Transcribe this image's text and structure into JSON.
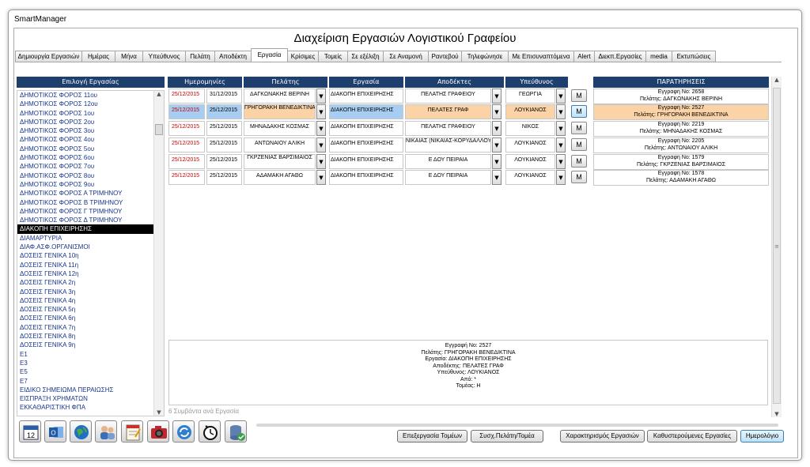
{
  "window_title": "SmartManager",
  "app_title": "Διαχείριση Εργασιών Λογιστικού Γραφείου",
  "tabs": [
    "Δημιουργία Εργασιών",
    "Ημέρας",
    "Μήνα",
    "Υπεύθυνος",
    "Πελάτη",
    "Αποδέκτη",
    "Εργασία",
    "Κρίσιμες",
    "Τομείς",
    "Σε εξέλιξη",
    "Σε Αναμονή",
    "Ραντεβού",
    "Τηλεφώνησε",
    "Με Επισυναπτόμενα",
    "Alert",
    "Διεκπ.Εργασίες",
    "media",
    "Εκτυπώσεις"
  ],
  "active_tab": "Εργασία",
  "left_header": "Επιλογή Εργασίας",
  "task_list": [
    "ΔΗΜΟΤΙΚΟΣ ΦΟΡΟΣ 11ου",
    "ΔΗΜΟΤΙΚΟΣ ΦΟΡΟΣ 12ου",
    "ΔΗΜΟΤΙΚΟΣ ΦΟΡΟΣ 1ου",
    "ΔΗΜΟΤΙΚΟΣ ΦΟΡΟΣ 2ου",
    "ΔΗΜΟΤΙΚΟΣ ΦΟΡΟΣ 3ου",
    "ΔΗΜΟΤΙΚΟΣ ΦΟΡΟΣ 4ου",
    "ΔΗΜΟΤΙΚΟΣ ΦΟΡΟΣ 5ου",
    "ΔΗΜΟΤΙΚΟΣ ΦΟΡΟΣ 6ου",
    "ΔΗΜΟΤΙΚΟΣ ΦΟΡΟΣ 7ου",
    "ΔΗΜΟΤΙΚΟΣ ΦΟΡΟΣ 8ου",
    "ΔΗΜΟΤΙΚΟΣ ΦΟΡΟΣ 9ου",
    "ΔΗΜΟΤΙΚΟΣ ΦΟΡΟΣ Α ΤΡΙΜΗΝΟΥ",
    "ΔΗΜΟΤΙΚΟΣ ΦΟΡΟΣ Β ΤΡΙΜΗΝΟΥ",
    "ΔΗΜΟΤΙΚΟΣ ΦΟΡΟΣ Γ ΤΡΙΜΗΝΟΥ",
    "ΔΗΜΟΤΙΚΟΣ ΦΟΡΟΣ Δ ΤΡΙΜΗΝΟΥ",
    "ΔΙΑΚΟΠΗ ΕΠΙΧΕΙΡΗΣΗΣ",
    "ΔΙΑΜΑΡΤΥΡΙΑ",
    "ΔΙΑΦ.ΑΣΦ.ΟΡΓΑΝΙΣΜΟΙ",
    "ΔΟΣΕΙΣ ΓΕΝΙΚΑ 10η",
    "ΔΟΣΕΙΣ ΓΕΝΙΚΑ 11η",
    "ΔΟΣΕΙΣ ΓΕΝΙΚΑ 12η",
    "ΔΟΣΕΙΣ ΓΕΝΙΚΑ 2η",
    "ΔΟΣΕΙΣ ΓΕΝΙΚΑ 3η",
    "ΔΟΣΕΙΣ ΓΕΝΙΚΑ 4η",
    "ΔΟΣΕΙΣ ΓΕΝΙΚΑ 5η",
    "ΔΟΣΕΙΣ ΓΕΝΙΚΑ 6η",
    "ΔΟΣΕΙΣ ΓΕΝΙΚΑ 7η",
    "ΔΟΣΕΙΣ ΓΕΝΙΚΑ 8η",
    "ΔΟΣΕΙΣ ΓΕΝΙΚΑ 9η",
    "Ε1",
    "Ε3",
    "Ε5",
    "Ε7",
    "ΕΙΔΙΚΟ ΣΗΜΕΙΩΜΑ ΠΕΡΑΙΩΣΗΣ",
    "ΕΙΣΠΡΑΞΗ ΧΡΗΜΑΤΩΝ",
    "ΕΚΚΑΘΑΡΙΣΤΙΚΗ ΦΠΑ"
  ],
  "selected_task": "ΔΙΑΚΟΠΗ ΕΠΙΧΕΙΡΗΣΗΣ",
  "columns": {
    "dates": "Ημερομηνίες",
    "client": "Πελάτης",
    "task": "Εργασία",
    "recipients": "Αποδέκτες",
    "responsible": "Υπεύθυνος",
    "notes": "ΠΑΡΑΤΗΡΗΣΕΙΣ"
  },
  "rows": [
    {
      "date1": "25/12/2015",
      "date2": "31/12/2015",
      "client": "ΔΑΓΚΩΝΑΚΗΣ ΒΕΡΙΝΗ",
      "task": "ΔΙΑΚΟΠΗ ΕΠΙΧΕΙΡΗΣΗΣ",
      "recipient": "ΠΕΛΑΤΗΣ ΓΡΑΦΕΙΟΥ",
      "responsible": "ΓΕΩΡΓΙΑ",
      "m": "M",
      "note1": "Εγγραφή Νο: 2658",
      "note2": "Πελάτης: ΔΑΓΚΩΝΑΚΗΣ ΒΕΡΙΝΗ"
    },
    {
      "date1": "25/12/2015",
      "date2": "25/12/2015",
      "client": "ΓΡΗΓΟΡΑΚΗ ΒΕΝΕΔΙΚΤΙΝΑ",
      "task": "ΔΙΑΚΟΠΗ ΕΠΙΧΕΙΡΗΣΗΣ",
      "recipient": "ΠΕΛΑΤΕΣ ΓΡΑΦ",
      "responsible": "ΛΟΥΚΙΑΝΟΣ",
      "m": "M",
      "note1": "Εγγραφή Νο: 2527",
      "note2": "Πελάτης: ΓΡΗΓΟΡΑΚΗ ΒΕΝΕΔΙΚΤΙΝΑ"
    },
    {
      "date1": "25/12/2015",
      "date2": "25/12/2015",
      "client": "ΜΗΝΑΔΑΚΗΣ ΚΟΣΜΑΣ",
      "task": "ΔΙΑΚΟΠΗ ΕΠΙΧΕΙΡΗΣΗΣ",
      "recipient": "ΠΕΛΑΤΗΣ ΓΡΑΦΕΙΟΥ",
      "responsible": "ΝΙΚΟΣ",
      "m": "M",
      "note1": "Εγγραφή Νο: 2219",
      "note2": "Πελάτης: ΜΗΝΑΔΑΚΗΣ ΚΟΣΜΑΣ"
    },
    {
      "date1": "25/12/2015",
      "date2": "25/12/2015",
      "client": "ΑΝΤΩΝΑΙΟΥ ΑΛΙΚΗ",
      "task": "ΔΙΑΚΟΠΗ ΕΠΙΧΕΙΡΗΣΗΣ",
      "recipient": "ΝΙΚΑΙΑΣ (ΝΙΚΑΙΑΣ-ΚΟΡΥΔΑΛΛΟΥ) Δ.Ο.Υ",
      "responsible": "ΛΟΥΚΙΑΝΟΣ",
      "m": "M",
      "note1": "Εγγραφή Νο: 2205",
      "note2": "Πελάτης: ΑΝΤΩΝΑΙΟΥ ΑΛΙΚΗ"
    },
    {
      "date1": "25/12/2015",
      "date2": "25/12/2015",
      "client": "ΓΚΡΖΕΝΙΑΣ ΒΑΡΣΙΜΑΙΟΣ",
      "task": "ΔΙΑΚΟΠΗ ΕΠΙΧΕΙΡΗΣΗΣ",
      "recipient": "Ε ΔΟΥ ΠΕΙΡΑΙΑ",
      "responsible": "ΛΟΥΚΙΑΝΟΣ",
      "m": "M",
      "note1": "Εγγραφή Νο: 1579",
      "note2": "Πελάτης: ΓΚΡΖΕΝΙΑΣ ΒΑΡΣΙΜΑΙΟΣ"
    },
    {
      "date1": "25/12/2015",
      "date2": "25/12/2015",
      "client": "ΑΔΑΜΑΚΗ ΑΓΑΘΩ",
      "task": "ΔΙΑΚΟΠΗ ΕΠΙΧΕΙΡΗΣΗΣ",
      "recipient": "Ε ΔΟΥ ΠΕΙΡΑΙΑ",
      "responsible": "ΛΟΥΚΙΑΝΟΣ",
      "m": "M",
      "note1": "Εγγραφή Νο: 1578",
      "note2": "Πελάτης: ΑΔΑΜΑΚΗ ΑΓΑΘΩ"
    }
  ],
  "selected_row_index": 1,
  "details": [
    "Εγγραφή Νο: 2527",
    "Πελάτης: ΓΡΗΓΟΡΑΚΗ ΒΕΝΕΔΙΚΤΙΝΑ",
    "Εργασία: ΔΙΑΚΟΠΗ ΕΠΙΧΕΙΡΗΣΗΣ",
    "Αποδέκτης: ΠΕΛΑΤΕΣ ΓΡΑΦ",
    "Υπεύθυνος: ΛΟΥΚΙΑΝΟΣ",
    "Από: *",
    "Τομέας: Η"
  ],
  "count_label": "6 Συμβάντα ανά Εργασία",
  "toolbar_icons": [
    "calendar-icon",
    "outlook-icon",
    "globe-icon",
    "contacts-icon",
    "notepad-icon",
    "camera-icon",
    "sync-icon",
    "clock-icon",
    "database-icon"
  ],
  "calendar_day": "12",
  "buttons": {
    "edit_sectors": "Επεξεργασία Τομέων",
    "link_client_sector": "Συσχ.Πελάτη/Τομέα",
    "task_characterization": "Χαρακτηρισμός Εργασιών",
    "overdue_tasks": "Καθυστερούμενες Εργασίες",
    "calendar": "Ημερολόγιο"
  },
  "colors": {
    "header_bg": "#1c3f6e",
    "selected_row_blue": "#a7cdf2",
    "selected_row_orange": "#fbd3a6",
    "date_red": "#c00000",
    "list_text": "#17368c"
  }
}
